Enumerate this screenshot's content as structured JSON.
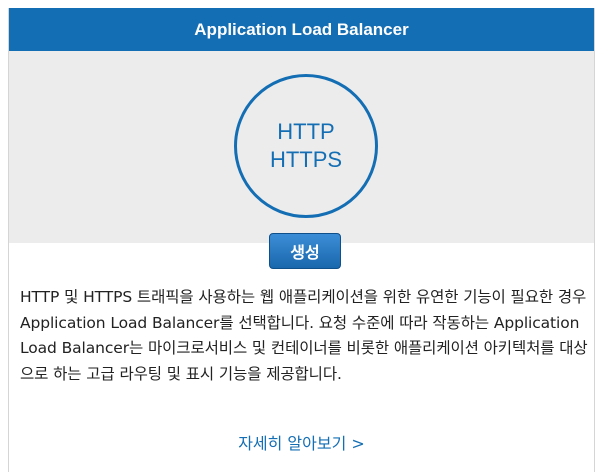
{
  "card": {
    "title": "Application Load Balancer",
    "icon": {
      "line1": "HTTP",
      "line2": "HTTPS"
    },
    "create_button_label": "생성",
    "description": "HTTP 및 HTTPS 트래픽을 사용하는 웹 애플리케이션을 위한 유연한 기능이 필요한 경우 Application Load Balancer를 선택합니다. 요청 수준에 따라 작동하는 Application Load Balancer는 마이크로서비스 및 컨테이너를 비롯한 애플리케이션 아키텍처를 대상으로 하는 고급 라우팅 및 표시 기능을 제공합니다.",
    "learn_more_link": "자세히 알아보기 >"
  },
  "colors": {
    "header_bg": "#146eb4",
    "hero_bg": "#ececec",
    "accent": "#146eb4",
    "button_bg": "#1a67ad",
    "text": "#222222"
  }
}
